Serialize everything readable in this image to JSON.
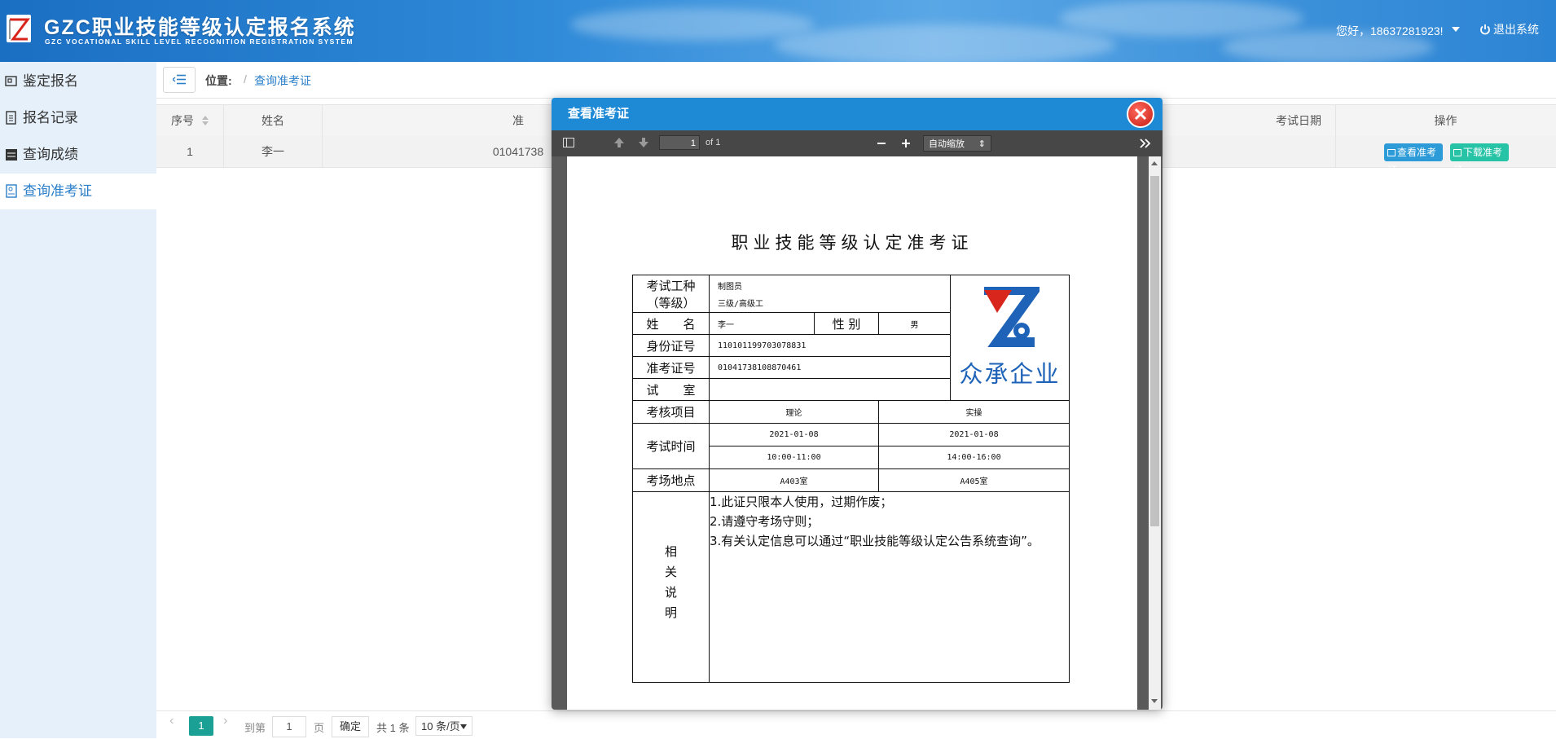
{
  "header": {
    "title": "GZC职业技能等级认定报名系统",
    "subtitle": "GZC VOCATIONAL SKILL LEVEL RECOGNITION REGISTRATION SYSTEM",
    "greeting": "您好，18637281923!",
    "logout_label": "退出系统"
  },
  "sidebar": {
    "items": [
      {
        "label": "鉴定报名",
        "icon": "register-icon"
      },
      {
        "label": "报名记录",
        "icon": "record-icon"
      },
      {
        "label": "查询成绩",
        "icon": "score-icon"
      },
      {
        "label": "查询准考证",
        "icon": "ticket-icon",
        "active": true
      }
    ]
  },
  "breadcrumb": {
    "label": "位置:",
    "separator": "/",
    "current": "查询准考证"
  },
  "table": {
    "headers": [
      "序号",
      "姓名",
      "准",
      "考试日期",
      "操作"
    ],
    "rows": [
      {
        "index": "1",
        "name": "李一",
        "ticket_partial": "01041738"
      }
    ],
    "view_button": "查看准考证",
    "download_button": "下载准考证"
  },
  "pagination": {
    "goto_label": "到第",
    "page_input": "1",
    "page_label": "页",
    "confirm": "确定",
    "total": "共 1 条",
    "page_size": "10 条/页",
    "current_page": "1"
  },
  "modal": {
    "title": "查看准考证",
    "pdf_toolbar": {
      "page_input": "1",
      "page_of": "of 1",
      "zoom": "自动缩放"
    },
    "card": {
      "title": "职业技能等级认定准考证",
      "labels": {
        "job_type": "考试工种",
        "job_level": "（等级）",
        "name": "姓　　名",
        "gender": "性 别",
        "id_number": "身份证号",
        "ticket_number": "准考证号",
        "room": "试　　室",
        "assessment": "考核项目",
        "exam_time": "考试时间",
        "location": "考场地点",
        "notes": "相关说明"
      },
      "values": {
        "job_type": "制图员",
        "job_level": "三级/高级工",
        "name": "李一",
        "gender": "男",
        "id_number": "110101199703078831",
        "ticket_number": "01041738108870461",
        "room": ""
      },
      "assessment": {
        "theory": "理论",
        "practical": "实操",
        "theory_date": "2021-01-08",
        "practical_date": "2021-01-08",
        "theory_time": "10:00-11:00",
        "practical_time": "14:00-16:00",
        "theory_location": "A403室",
        "practical_location": "A405室"
      },
      "notes": [
        "1.此证只限本人使用，过期作废；",
        "2.请遵守考场守则；",
        "3.有关认定信息可以通过“职业技能等级认定公告系统查询”。"
      ],
      "company_name": "众承企业"
    }
  },
  "colors": {
    "header_blue": "#2c84d4",
    "accent_blue": "#2b7fc9",
    "pager_active": "#1aa094",
    "view_btn": "#2d9bd8",
    "download_btn": "#27c3a6",
    "modal_title": "#1e8ad5"
  }
}
